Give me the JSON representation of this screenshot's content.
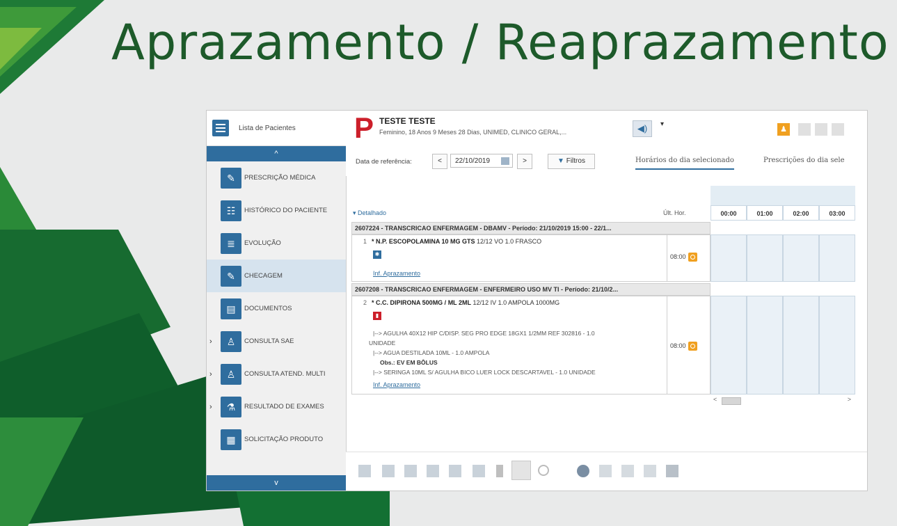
{
  "slide": {
    "title": "Aprazamento / Reaprazamento",
    "colors": {
      "title": "#1d5a2a",
      "deco_dark": "#0e5a2a",
      "deco_light": "#5aa63a"
    }
  },
  "sidebar": {
    "header_label": "Lista de Pacientes",
    "scroll_up_glyph": "^",
    "scroll_down_glyph": "v",
    "items": [
      {
        "label": "PRESCRIÇÃO MÉDICA",
        "icon": "prescription-icon",
        "expandable": false,
        "active": false
      },
      {
        "label": "HISTÓRICO DO PACIENTE",
        "icon": "history-icon",
        "expandable": false,
        "active": false
      },
      {
        "label": "EVOLUÇÃO",
        "icon": "evolution-icon",
        "expandable": false,
        "active": false
      },
      {
        "label": "CHECAGEM",
        "icon": "check-icon",
        "expandable": false,
        "active": true
      },
      {
        "label": "DOCUMENTOS",
        "icon": "documents-icon",
        "expandable": false,
        "active": false
      },
      {
        "label": "CONSULTA SAE",
        "icon": "nurse-icon",
        "expandable": true,
        "active": false
      },
      {
        "label": "CONSULTA ATEND. MULTI",
        "icon": "multi-team-icon",
        "expandable": true,
        "active": false
      },
      {
        "label": "RESULTADO DE EXAMES",
        "icon": "microscope-icon",
        "expandable": true,
        "active": false
      },
      {
        "label": "SOLICITAÇÃO PRODUTO",
        "icon": "product-request-icon",
        "expandable": false,
        "active": false
      }
    ]
  },
  "header": {
    "logo_letter": "P",
    "patient_name": "TESTE TESTE",
    "patient_info": "Feminino, 18 Anos 9 Meses 28 Dias, UNIMED, CLINICO GERAL,...",
    "speaker_icon": "speaker-icon",
    "dropdown_glyph": "▾",
    "user_badge_glyph": "♟"
  },
  "toolbar": {
    "ref_label": "Data de referência:",
    "prev_glyph": "<",
    "next_glyph": ">",
    "date_value": "22/10/2019",
    "filter_label": "Filtros",
    "tab_active": "Horários do dia selecionado",
    "tab_other": "Prescrições do dia sele"
  },
  "grid": {
    "detail_label": "Detalhado",
    "last_hour_label": "Últ. Hor.",
    "hours": [
      "00:00",
      "01:00",
      "02:00",
      "03:00"
    ],
    "sections": [
      {
        "title": "2607224 - TRANSCRICAO ENFERMAGEM - DBAMV - Período: 21/10/2019 15:00 - 22/1...",
        "prescription": {
          "number": "1",
          "drug_name": "* N.P. ESCOPOLAMINA  10 MG GTS",
          "dose": "12/12 VO 1.0 FRASCO",
          "last_time": "08:00",
          "link": "Inf. Aprazamento",
          "lines": []
        }
      },
      {
        "title": "2607208 - TRANSCRICAO ENFERMAGEM - ENFERMEIRO USO MV TI - Período: 21/10/2...",
        "prescription": {
          "number": "2",
          "drug_name": "* C.C. DIPIRONA 500MG / ML 2ML",
          "dose": "12/12 IV 1.0 AMPOLA 1000MG",
          "last_time": "08:00",
          "link": "Inf. Aprazamento",
          "lines": [
            "|--> AGULHA 40X12 HIP C/DISP. SEG PRO EDGE 18GX1 1/2MM REF 302816 - 1.0",
            "UNIDADE",
            "|--> AGUA DESTILADA 10ML - 1.0 AMPOLA",
            "Obs.: EV EM BÔLUS",
            "|--> SERINGA 10ML S/ AGULHA BICO LUER LOCK DESCARTAVEL - 1.0 UNIDADE"
          ]
        }
      }
    ],
    "scroll_left_glyph": "<",
    "scroll_right_glyph": ">"
  },
  "bottom_toolbar": {
    "icons": [
      "check-item-icon",
      "check-all-icon",
      "add-check-icon",
      "schedule-icon",
      "unschedule-icon",
      "suspend-icon",
      "delete-icon",
      "copy-icon",
      "link-icon",
      "reschedule-icon",
      "print-check-icon",
      "move-icon",
      "cancel-doc-icon",
      "print-icon"
    ]
  }
}
